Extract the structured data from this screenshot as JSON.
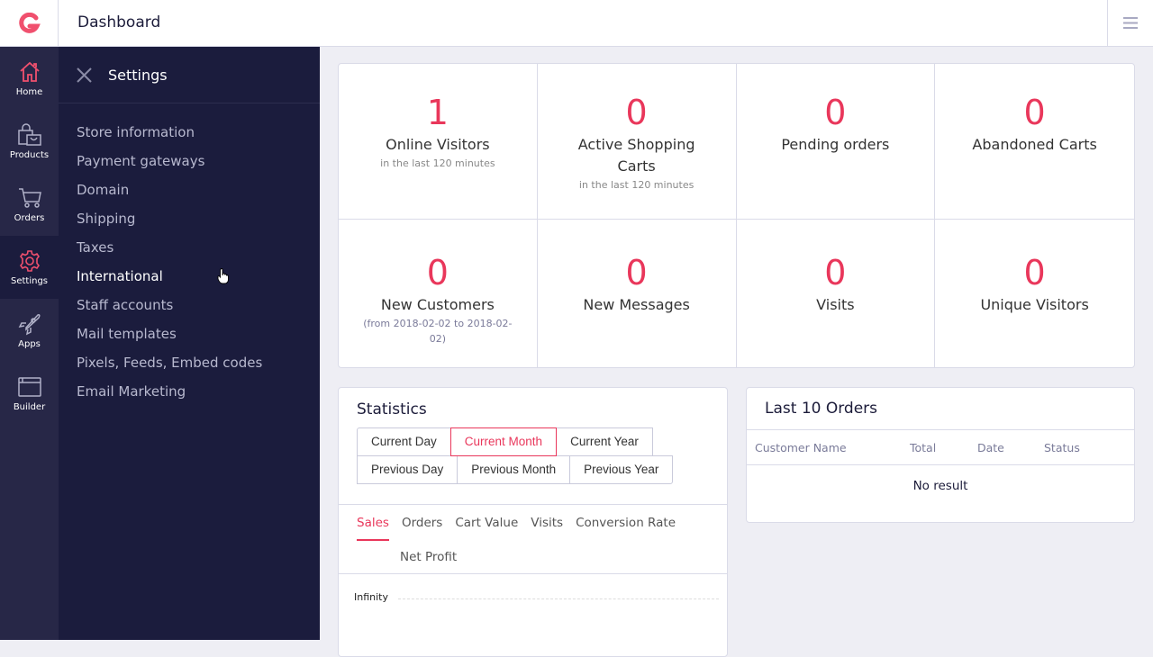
{
  "header": {
    "title": "Dashboard",
    "brand_color": "#f0506e"
  },
  "rail": [
    {
      "label": "Home",
      "icon": "home-icon",
      "active": false
    },
    {
      "label": "Products",
      "icon": "shopping-bag-icon",
      "active": false
    },
    {
      "label": "Orders",
      "icon": "cart-icon",
      "active": false
    },
    {
      "label": "Settings",
      "icon": "gear-icon",
      "active": true
    },
    {
      "label": "Apps",
      "icon": "rocket-icon",
      "active": false
    },
    {
      "label": "Builder",
      "icon": "browser-window-icon",
      "active": false
    }
  ],
  "settings_nav": {
    "title": "Settings",
    "items": [
      "Store information",
      "Payment gateways",
      "Domain",
      "Shipping",
      "Taxes",
      "International",
      "Staff accounts",
      "Mail templates",
      "Pixels, Feeds, Embed codes",
      "Email Marketing"
    ],
    "hovered": "International"
  },
  "stats": [
    {
      "value": "1",
      "label": "Online Visitors",
      "sub": "in the last 120 minutes"
    },
    {
      "value": "0",
      "label": "Active Shopping Carts",
      "sub": "in the last 120 minutes"
    },
    {
      "value": "0",
      "label": "Pending orders",
      "sub": ""
    },
    {
      "value": "0",
      "label": "Abandoned Carts",
      "sub": ""
    },
    {
      "value": "0",
      "label": "New Customers",
      "sub": "(from 2018-02-02 to 2018-02-02)"
    },
    {
      "value": "0",
      "label": "New Messages",
      "sub": ""
    },
    {
      "value": "0",
      "label": "Visits",
      "sub": ""
    },
    {
      "value": "0",
      "label": "Unique Visitors",
      "sub": ""
    }
  ],
  "statistics": {
    "title": "Statistics",
    "periods": [
      "Current Day",
      "Current Month",
      "Current Year",
      "Previous Day",
      "Previous Month",
      "Previous Year"
    ],
    "active_period": "Current Month",
    "tabs": [
      "Sales",
      "Orders",
      "Cart Value",
      "Visits",
      "Conversion Rate",
      "Net Profit"
    ],
    "active_tab": "Sales",
    "y_axis_label": "Infinity"
  },
  "orders": {
    "title": "Last 10 Orders",
    "columns": [
      "Customer Name",
      "Total",
      "Date",
      "Status"
    ],
    "empty_text": "No result"
  },
  "accent_color": "#e9375b"
}
